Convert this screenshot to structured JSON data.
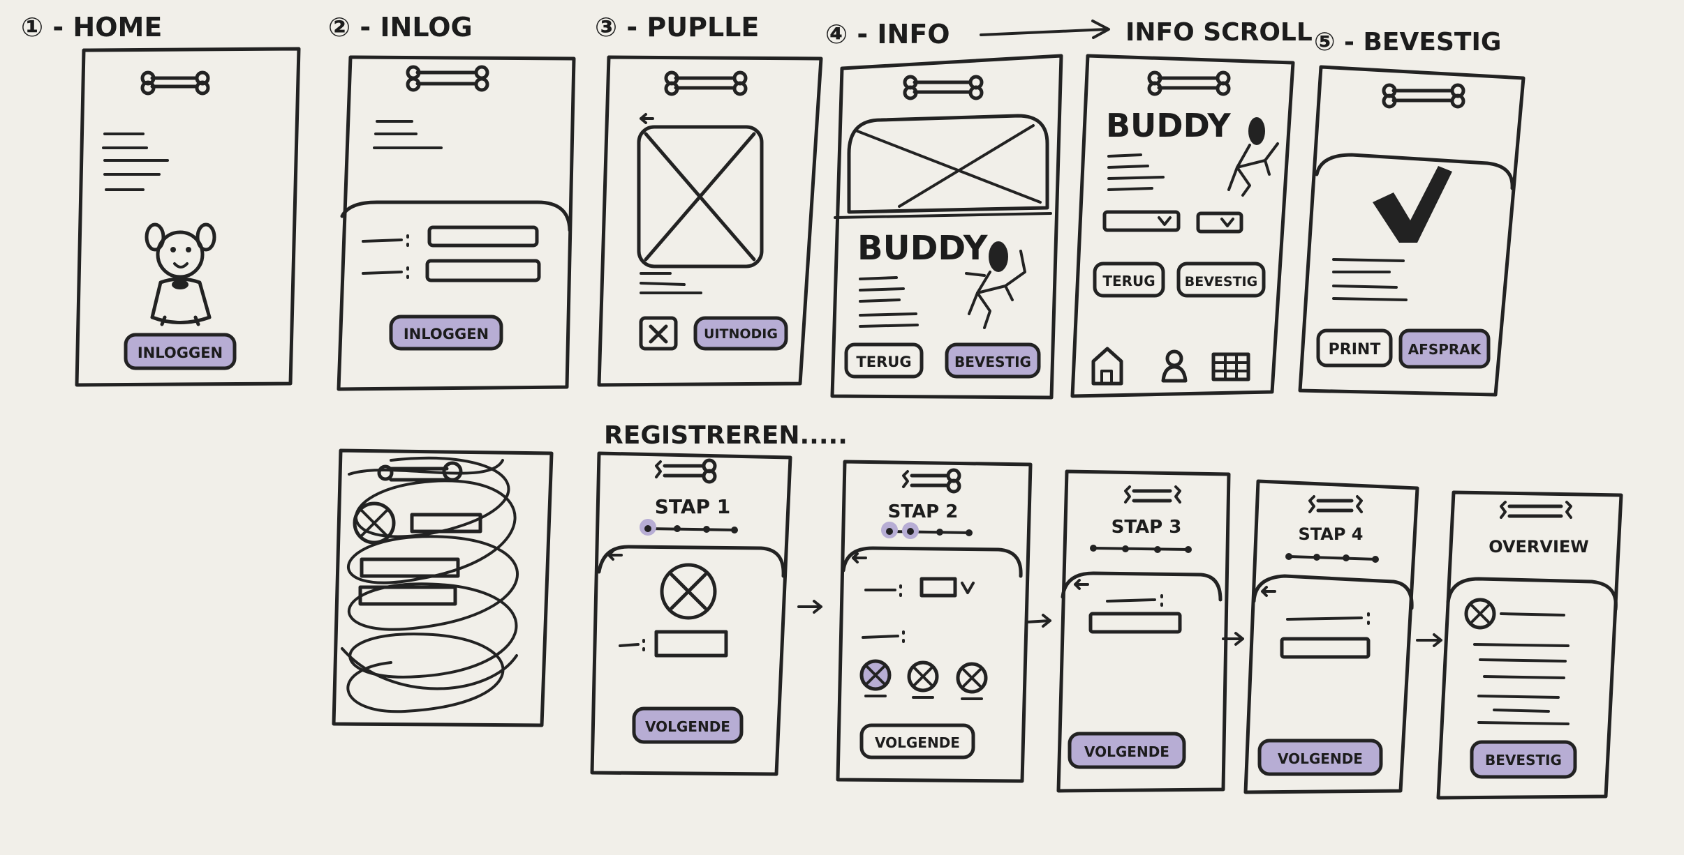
{
  "headings": {
    "home": "① - HOME",
    "inlog": "② - INLOG",
    "pupile": "③ - PUPLLE",
    "info": "④ - INFO",
    "info_scroll": "INFO SCROLL",
    "bevestig": "⑤ - BEVESTIG",
    "registreren": "REGISTREREN....."
  },
  "buttons": {
    "home_inloggen": "INLOGGEN",
    "inlog_inloggen": "INLOGGEN",
    "pupile_uitnodig": "UITNODIG",
    "info_terug": "TERUG",
    "info_bevestig": "BEVESTIG",
    "scroll_terug": "TERUG",
    "scroll_bevestig": "BEVESTIG",
    "bev_print": "PRINT",
    "bev_afspraak": "AFSPRAK",
    "volgende_1": "VOLGENDE",
    "volgende_2": "VOLGENDE",
    "volgende_3": "VOLGENDE",
    "volgende_4": "VOLGENDE",
    "overview_bevestig": "BEVESTIG"
  },
  "labels": {
    "buddy_info": "BUDDY",
    "buddy_scroll": "BUDDY",
    "stap1": "STAP 1",
    "stap2": "STAP 2",
    "stap3": "STAP 3",
    "stap4": "STAP 4",
    "overview": "OVERVIEW"
  },
  "colors": {
    "ink": "#222222",
    "paper": "#f1efe9",
    "highlight": "#b7add4"
  }
}
